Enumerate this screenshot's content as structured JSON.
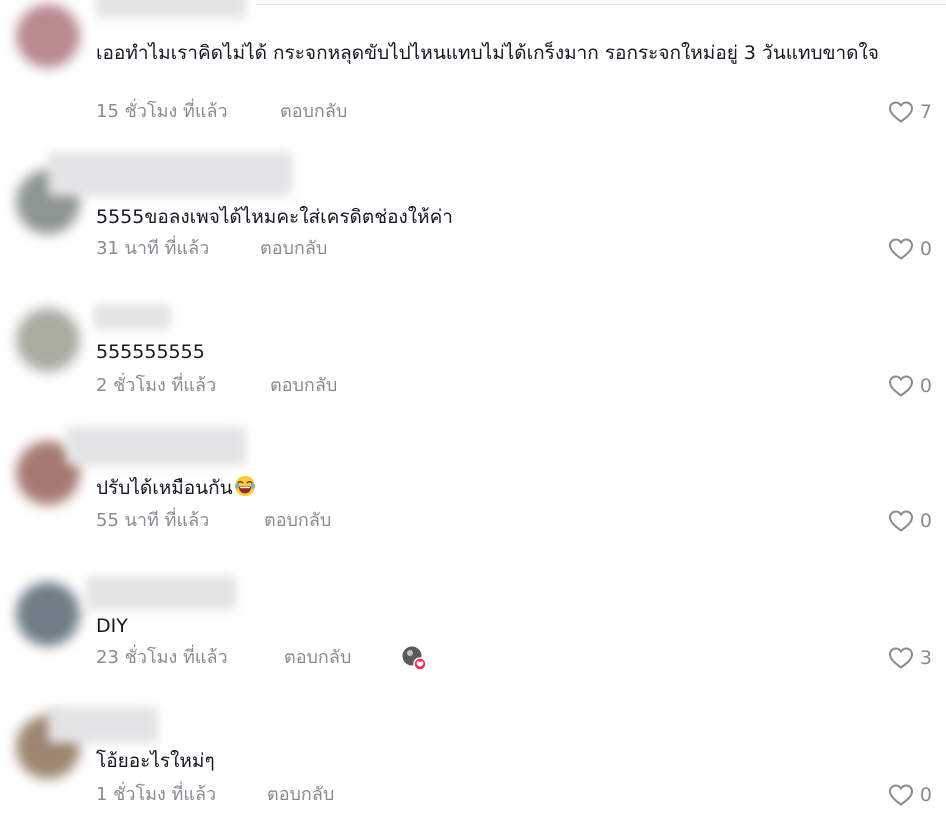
{
  "reply_label": "ตอบกลับ",
  "comments": [
    {
      "text": "เออทำไมเราคิดไม่ได้ กระจกหลุดขับไปไหนแทบไม่ได้เกร็งมาก รอกระจกใหม่อยู่ 3 วันแทบขาดใจ",
      "time": "15 ชั่วโมง ที่แล้ว",
      "likes": "7",
      "avatar_color": "#b98a8e"
    },
    {
      "text": "5555ขอลงเพจได้ไหมคะใส่เครดิตช่องให้ค่า",
      "time": "31 นาที ที่แล้ว",
      "likes": "0",
      "avatar_color": "#8d9690"
    },
    {
      "text": "555555555",
      "time": "2 ชั่วโมง ที่แล้ว",
      "likes": "0",
      "avatar_color": "#a9ada0"
    },
    {
      "text": "ปรับได้เหมือนกัน",
      "time": "55 นาที ที่แล้ว",
      "likes": "0",
      "avatar_color": "#a67a72"
    },
    {
      "text": "DIY",
      "time": "23 ชั่วโมง ที่แล้ว",
      "likes": "3",
      "avatar_color": "#6f7d86"
    },
    {
      "text": "โอ้ยอะไรใหม่ๆ",
      "time": "1 ชั่วโมง ที่แล้ว",
      "likes": "0",
      "avatar_color": "#9c8670"
    }
  ]
}
